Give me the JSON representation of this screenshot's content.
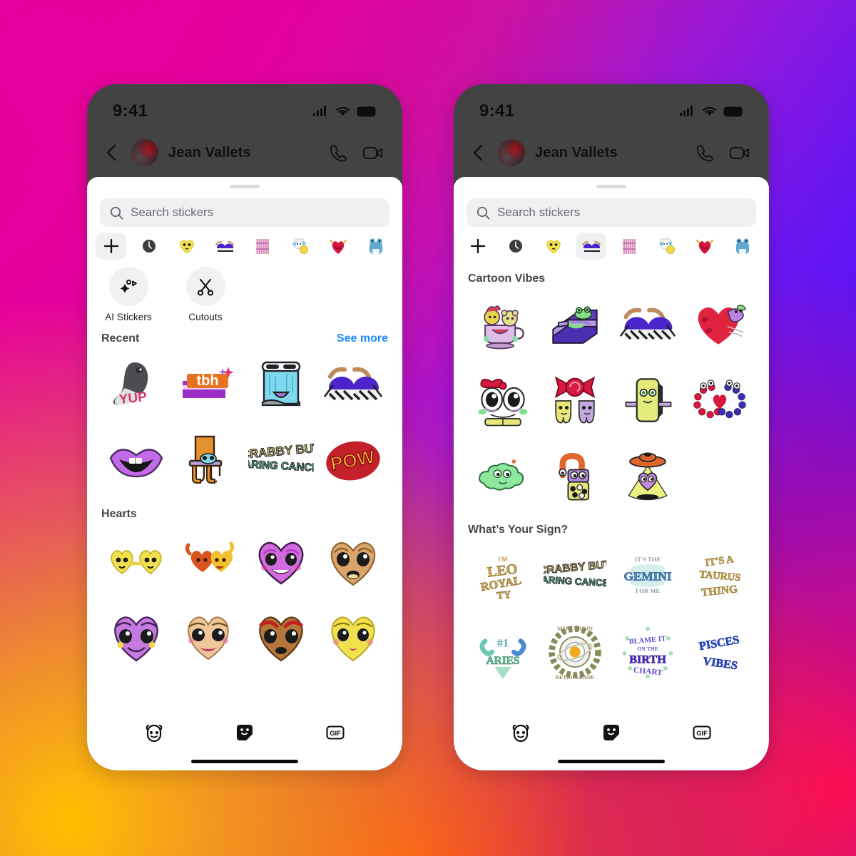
{
  "background": {
    "gradient_stops": [
      "#e6009c",
      "#5512f0",
      "#ffc000",
      "#fa0a5a"
    ],
    "description": "instagram-gradient"
  },
  "phones": [
    {
      "id": "phone-left",
      "status_bar": {
        "time": "9:41",
        "icons": [
          "cellular-signal-icon",
          "wifi-icon",
          "battery-icon"
        ]
      },
      "chat_header": {
        "back_label": "back-chevron",
        "peer_name": "Jean Vallets",
        "actions": [
          "audio-call-icon",
          "video-call-icon"
        ]
      },
      "sheet": {
        "search": {
          "placeholder": "Search stickers"
        },
        "tabs": [
          {
            "name": "add-sticker-pack",
            "icon": "plus-icon",
            "selected": true
          },
          {
            "name": "recents",
            "icon": "clock-icon",
            "selected": false
          },
          {
            "name": "pack-yellow-heart",
            "icon": "yellow-heart-sticker",
            "selected": false
          },
          {
            "name": "pack-eyes",
            "icon": "purple-eyes-sticker",
            "selected": false
          },
          {
            "name": "pack-pink-pattern",
            "icon": "pink-pattern-sticker",
            "selected": false
          },
          {
            "name": "pack-white-bear",
            "icon": "white-bear-sticker",
            "selected": false
          },
          {
            "name": "pack-red-apple",
            "icon": "red-apple-sticker",
            "selected": false
          },
          {
            "name": "pack-blue-frog",
            "icon": "blue-frog-sticker",
            "selected": false
          }
        ],
        "quick_actions": [
          {
            "label": "AI Stickers",
            "icon": "ai-sparkle-icon"
          },
          {
            "label": "Cutouts",
            "icon": "scissors-icon"
          }
        ],
        "sections": [
          {
            "title": "Recent",
            "action_label": "See more",
            "stickers": [
              "pigeon-yup-sticker",
              "tbh-text-sticker",
              "crying-waterfall-sticker",
              "sunglasses-eyes-sticker",
              "purple-lips-sticker",
              "orange-table-creature-sticker",
              "crabby-but-caring-cancer-sticker",
              "pow-burst-sticker"
            ]
          },
          {
            "title": "Hearts",
            "action_label": "",
            "stickers": [
              "yellow-twin-hearts-sticker",
              "orange-yellow-hug-sticker",
              "purple-smiling-heart-sticker",
              "tan-heart-face-sticker",
              "purple-heart-alien-sticker",
              "peach-lady-heart-sticker",
              "brown-heart-brows-sticker",
              "yellow-heart-kiss-sticker"
            ]
          }
        ],
        "dock": [
          {
            "name": "emoji-tab",
            "icon": "emoji-face-icon",
            "selected": false
          },
          {
            "name": "stickers-tab",
            "icon": "sticker-icon",
            "selected": true
          },
          {
            "name": "gif-tab",
            "icon": "gif-icon",
            "label": "GIF",
            "selected": false
          }
        ]
      }
    },
    {
      "id": "phone-right",
      "status_bar": {
        "time": "9:41",
        "icons": [
          "cellular-signal-icon",
          "wifi-icon",
          "battery-icon"
        ]
      },
      "chat_header": {
        "back_label": "back-chevron",
        "peer_name": "Jean Vallets",
        "actions": [
          "audio-call-icon",
          "video-call-icon"
        ]
      },
      "sheet": {
        "search": {
          "placeholder": "Search stickers"
        },
        "tabs": [
          {
            "name": "add-sticker-pack",
            "icon": "plus-icon",
            "selected": false
          },
          {
            "name": "recents",
            "icon": "clock-icon",
            "selected": false
          },
          {
            "name": "pack-yellow-heart",
            "icon": "yellow-heart-sticker",
            "selected": false
          },
          {
            "name": "pack-eyes",
            "icon": "purple-eyes-sticker",
            "selected": true
          },
          {
            "name": "pack-pink-pattern",
            "icon": "pink-pattern-sticker",
            "selected": false
          },
          {
            "name": "pack-white-bear",
            "icon": "white-bear-sticker",
            "selected": false
          },
          {
            "name": "pack-red-apple",
            "icon": "red-apple-sticker",
            "selected": false
          },
          {
            "name": "pack-blue-frog",
            "icon": "blue-frog-sticker",
            "selected": false
          }
        ],
        "sections": [
          {
            "title": "Cartoon Vibes",
            "action_label": "",
            "stickers": [
              "teacup-friends-sticker",
              "frog-sofa-sticker",
              "sunglasses-eyes-sticker",
              "red-heart-bird-sticker",
              "big-eyes-bow-sticker",
              "candy-teeth-sticker",
              "green-phone-face-sticker",
              "beaded-bracelets-sticker",
              "green-cloud-face-sticker",
              "boba-lock-sticker",
              "ufo-heart-sticker"
            ]
          },
          {
            "title": "What’s Your Sign?",
            "action_label": "",
            "stickers": [
              "leo-royalty-text-sticker",
              "crabby-but-caring-cancer-sticker",
              "its-the-gemini-for-me-sticker",
              "its-a-taurus-thing-sticker",
              "number-one-aries-sticker",
              "mercury-in-retrograde-sticker",
              "blame-it-on-the-birth-chart-sticker",
              "pisces-vibes-sticker"
            ]
          }
        ],
        "dock": [
          {
            "name": "emoji-tab",
            "icon": "emoji-face-icon",
            "selected": false
          },
          {
            "name": "stickers-tab",
            "icon": "sticker-icon",
            "selected": true
          },
          {
            "name": "gif-tab",
            "icon": "gif-icon",
            "label": "GIF",
            "selected": false
          }
        ]
      }
    }
  ]
}
